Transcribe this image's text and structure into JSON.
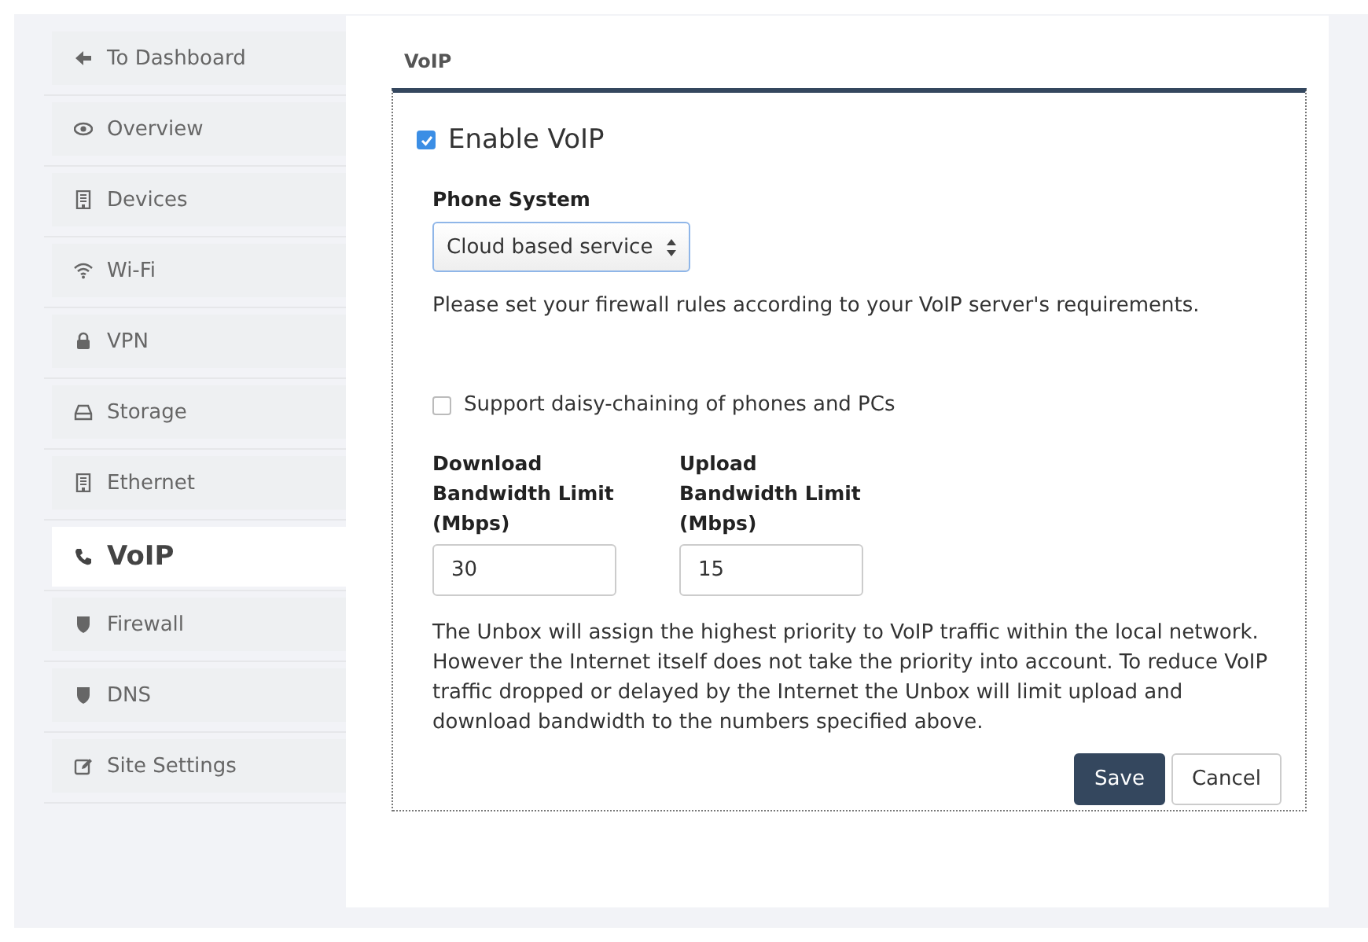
{
  "sidebar": {
    "items": [
      {
        "label": "To Dashboard",
        "selected": false
      },
      {
        "label": "Overview",
        "selected": false
      },
      {
        "label": "Devices",
        "selected": false
      },
      {
        "label": "Wi-Fi",
        "selected": false
      },
      {
        "label": "VPN",
        "selected": false
      },
      {
        "label": "Storage",
        "selected": false
      },
      {
        "label": "Ethernet",
        "selected": false
      },
      {
        "label": "VoIP",
        "selected": true
      },
      {
        "label": "Firewall",
        "selected": false
      },
      {
        "label": "DNS",
        "selected": false
      },
      {
        "label": "Site Settings",
        "selected": false
      }
    ]
  },
  "panel": {
    "title": "VoIP",
    "enable": {
      "label": "Enable VoIP",
      "checked": true
    },
    "phone_system": {
      "label": "Phone System",
      "value": "Cloud based service"
    },
    "firewall_note": "Please set your firewall rules according to your VoIP server's requirements.",
    "daisy_chain": {
      "label": "Support daisy-chaining of phones and PCs",
      "checked": false
    },
    "limits": [
      {
        "label": "Download Bandwidth Limit (Mbps)",
        "value": "30"
      },
      {
        "label": "Upload Bandwidth Limit (Mbps)",
        "value": "15"
      }
    ],
    "description": "The Unbox will assign the highest priority to VoIP traffic within the local network. However the Internet itself does not take the priority into account. To reduce VoIP traffic dropped or delayed by the Internet the Unbox will limit upload and download bandwidth to the numbers specified above.",
    "buttons": [
      {
        "label": "Save",
        "kind": "primary"
      },
      {
        "label": "Cancel",
        "kind": "secondary"
      }
    ]
  }
}
